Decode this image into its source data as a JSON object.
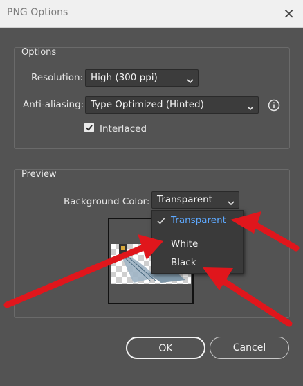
{
  "window": {
    "title": "PNG Options",
    "close_glyph": "✕"
  },
  "options": {
    "group_title": "Options",
    "resolution_label": "Resolution:",
    "resolution_value": "High (300 ppi)",
    "antialias_label": "Anti-aliasing:",
    "antialias_value": "Type Optimized (Hinted)",
    "interlaced_label": "Interlaced",
    "interlaced_checked": true
  },
  "preview": {
    "group_title": "Preview",
    "bg_label": "Background Color:",
    "bg_value": "Transparent",
    "bg_options": [
      {
        "label": "Transparent",
        "selected": true
      },
      {
        "label": "White",
        "selected": false
      },
      {
        "label": "Black",
        "selected": false
      }
    ]
  },
  "buttons": {
    "ok": "OK",
    "cancel": "Cancel"
  },
  "icons": {
    "info": "info-circle-icon",
    "chevron": "chevron-down-icon",
    "check": "checkmark-icon",
    "close": "close-icon"
  },
  "colors": {
    "dialog_bg": "#535353",
    "field_bg": "#3c3c3c",
    "selected_item": "#5ea9ff",
    "annotation_arrow": "#e0161c"
  }
}
